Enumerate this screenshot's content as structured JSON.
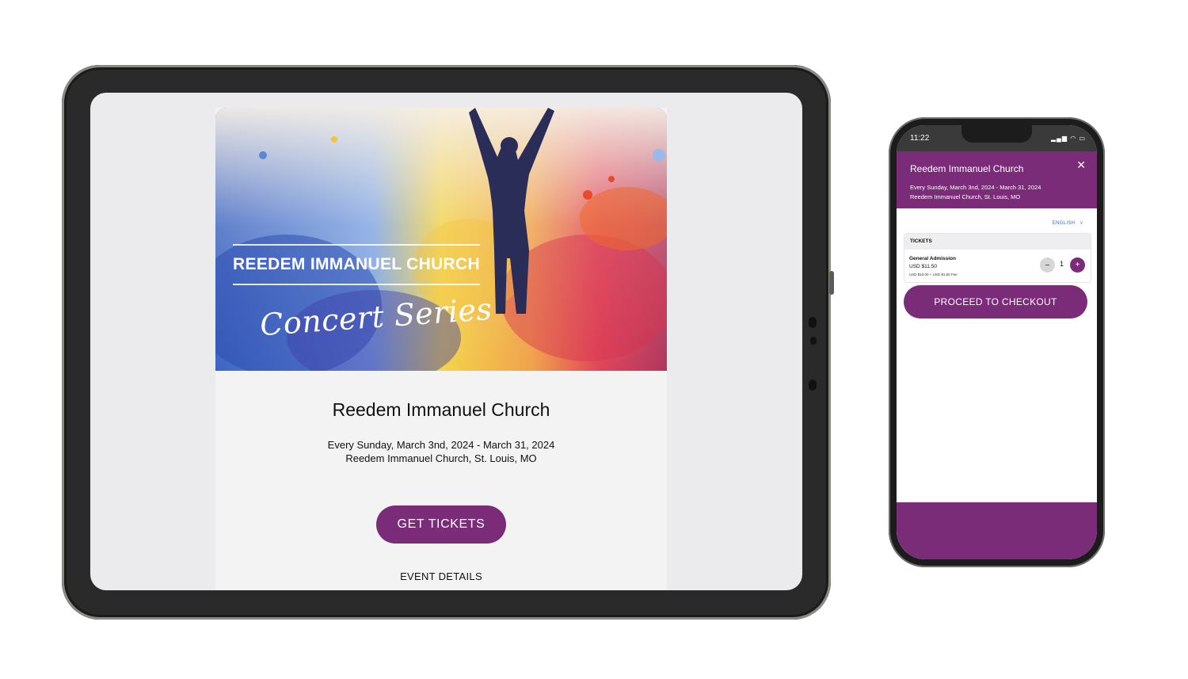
{
  "tablet": {
    "banner": {
      "title": "REEDEM IMMANUEL CHURCH",
      "script_text": "Concert Series"
    },
    "event": {
      "title": "Reedem Immanuel Church",
      "dates": "Every Sunday, March 3nd, 2024 - March 31, 2024",
      "location": "Reedem Immanuel Church, St. Louis, MO"
    },
    "get_tickets_label": "GET TICKETS",
    "event_details_label": "EVENT DETAILS"
  },
  "phone": {
    "status_time": "11:22",
    "header": {
      "title": "Reedem Immanuel Church",
      "dates": "Every Sunday, March 3nd, 2024 - March 31, 2024",
      "location": "Reedem Immanuel Church, St. Louis, MO",
      "close_icon": "close-icon"
    },
    "language": "ENGLISH",
    "tickets": {
      "heading": "TICKETS",
      "item": {
        "name": "General Admission",
        "price": "USD $11.50",
        "fee_note": "USD $10.00 + USD $1.50 Fee",
        "quantity": "1"
      }
    },
    "checkout_label": "PROCEED TO CHECKOUT"
  },
  "colors": {
    "brand_purple": "#7b2c78",
    "link_blue": "#2a6fd6"
  }
}
